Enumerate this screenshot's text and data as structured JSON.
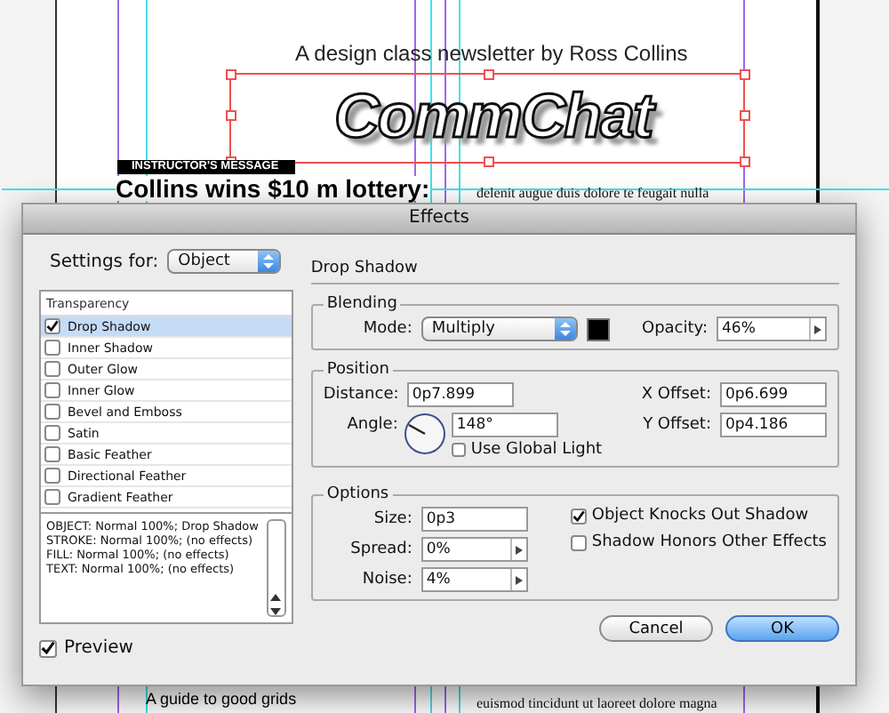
{
  "document": {
    "tagline": "A design class newsletter by Ross Collins",
    "logo": "CommChat",
    "section_label": "INSTRUCTOR'S MESSAGE",
    "headline": "Collins wins $10 m lottery:",
    "column_text_top": "delenit augue duis dolore te feugait nulla",
    "bottom_heading": "A guide to good grids",
    "column_text_bottom": "euismod tincidunt ut laoreet dolore magna"
  },
  "dialog": {
    "title": "Effects",
    "settings_for": {
      "label": "Settings for:",
      "value": "Object"
    },
    "list_header": "Transparency",
    "effects": [
      {
        "label": "Drop Shadow",
        "checked": true,
        "selected": true
      },
      {
        "label": "Inner Shadow",
        "checked": false,
        "selected": false
      },
      {
        "label": "Outer Glow",
        "checked": false,
        "selected": false
      },
      {
        "label": "Inner Glow",
        "checked": false,
        "selected": false
      },
      {
        "label": "Bevel and Emboss",
        "checked": false,
        "selected": false
      },
      {
        "label": "Satin",
        "checked": false,
        "selected": false
      },
      {
        "label": "Basic Feather",
        "checked": false,
        "selected": false
      },
      {
        "label": "Directional Feather",
        "checked": false,
        "selected": false
      },
      {
        "label": "Gradient Feather",
        "checked": false,
        "selected": false
      }
    ],
    "summary": [
      "OBJECT: Normal 100%; Drop Shadow",
      "STROKE: Normal 100%; (no effects)",
      "FILL: Normal 100%; (no effects)",
      "TEXT: Normal 100%; (no effects)"
    ],
    "preview": {
      "label": "Preview",
      "checked": true
    },
    "panel_title": "Drop Shadow",
    "blending": {
      "title": "Blending",
      "mode_label": "Mode:",
      "mode": "Multiply",
      "color": "#000000",
      "opacity_label": "Opacity:",
      "opacity": "46%"
    },
    "position": {
      "title": "Position",
      "distance_label": "Distance:",
      "distance": "0p7.899",
      "angle_label": "Angle:",
      "angle": "148°",
      "x_offset_label": "X Offset:",
      "x_offset": "0p6.699",
      "y_offset_label": "Y Offset:",
      "y_offset": "0p4.186",
      "global_light": {
        "label": "Use Global Light",
        "checked": false
      }
    },
    "options": {
      "title": "Options",
      "size_label": "Size:",
      "size": "0p3",
      "spread_label": "Spread:",
      "spread": "0%",
      "noise_label": "Noise:",
      "noise": "4%",
      "checkboxes": [
        {
          "label": "Object Knocks Out Shadow",
          "checked": true
        },
        {
          "label": "Shadow Honors Other Effects",
          "checked": false
        }
      ]
    },
    "buttons": [
      {
        "label": "Cancel",
        "kind": "secondary"
      },
      {
        "label": "OK",
        "kind": "primary"
      }
    ]
  }
}
